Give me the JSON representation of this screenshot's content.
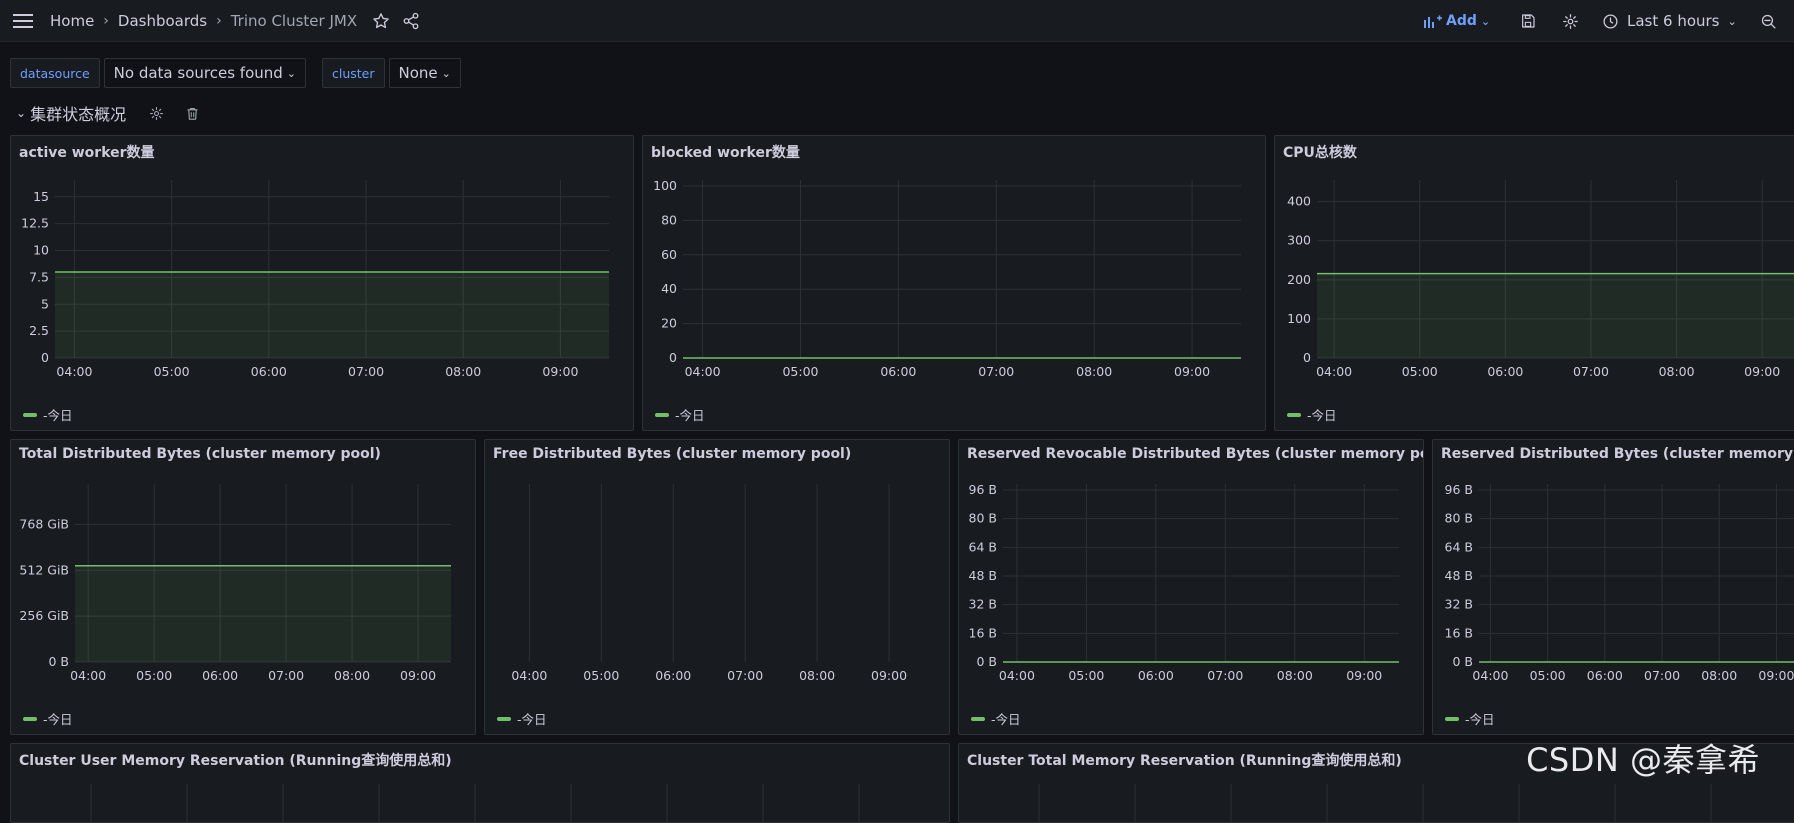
{
  "topbar": {
    "breadcrumbs": [
      "Home",
      "Dashboards",
      "Trino Cluster JMX"
    ],
    "add_label": "Add",
    "time_range": "Last 6 hours"
  },
  "variables": [
    {
      "label": "datasource",
      "value": "No data sources found"
    },
    {
      "label": "cluster",
      "value": "None"
    }
  ],
  "row": {
    "title": "集群状态概况"
  },
  "watermark": "CSDN @秦拿希",
  "colors": {
    "series": "#73bf69",
    "accent": "#6e9fff",
    "panel_bg": "#181b1f",
    "page_bg": "#111217"
  },
  "panels": [
    {
      "title": "active worker数量",
      "legend": "-今日",
      "chart_data": {
        "type": "area",
        "series_name": "-今日",
        "x": [
          "04:00",
          "05:00",
          "06:00",
          "07:00",
          "08:00",
          "09:00"
        ],
        "value": 8,
        "ylim": [
          0,
          16
        ],
        "yticks": [
          0,
          2.5,
          5,
          7.5,
          10,
          12.5,
          15
        ],
        "ytick_labels": [
          "0",
          "2.5",
          "5",
          "7.5",
          "10",
          "12.5",
          "15"
        ]
      }
    },
    {
      "title": "blocked worker数量",
      "legend": "-今日",
      "chart_data": {
        "type": "line",
        "series_name": "-今日",
        "x": [
          "04:00",
          "05:00",
          "06:00",
          "07:00",
          "08:00",
          "09:00"
        ],
        "value": 0,
        "ylim": [
          0,
          100
        ],
        "yticks": [
          0,
          20,
          40,
          60,
          80,
          100
        ],
        "ytick_labels": [
          "0",
          "20",
          "40",
          "60",
          "80",
          "100"
        ]
      }
    },
    {
      "title": "CPU总核数",
      "legend": "-今日",
      "chart_data": {
        "type": "area",
        "series_name": "-今日",
        "x": [
          "04:00",
          "05:00",
          "06:00",
          "07:00",
          "08:00",
          "09:00"
        ],
        "value": 216,
        "ylim": [
          0,
          440
        ],
        "yticks": [
          0,
          100,
          200,
          300,
          400
        ],
        "ytick_labels": [
          "0",
          "100",
          "200",
          "300",
          "400"
        ]
      }
    },
    {
      "title": "Total Distributed Bytes (cluster memory pool)",
      "legend": "-今日",
      "chart_data": {
        "type": "area",
        "series_name": "-今日",
        "x": [
          "04:00",
          "05:00",
          "06:00",
          "07:00",
          "08:00",
          "09:00"
        ],
        "value": 537,
        "ylim": [
          0,
          960
        ],
        "yticks": [
          0,
          256,
          512,
          768
        ],
        "ytick_labels": [
          "0 B",
          "256 GiB",
          "512 GiB",
          "768 GiB"
        ]
      }
    },
    {
      "title": "Free Distributed Bytes (cluster memory pool)",
      "legend": "-今日",
      "chart_data": {
        "type": "line",
        "series_name": "-今日",
        "x": [
          "04:00",
          "05:00",
          "06:00",
          "07:00",
          "08:00",
          "09:00"
        ],
        "value": null,
        "ylim": [
          0,
          1
        ],
        "yticks": [],
        "ytick_labels": []
      }
    },
    {
      "title": "Reserved Revocable Distributed Bytes (cluster memory pool)",
      "legend": "-今日",
      "chart_data": {
        "type": "line",
        "series_name": "-今日",
        "x": [
          "04:00",
          "05:00",
          "06:00",
          "07:00",
          "08:00",
          "09:00"
        ],
        "value": 0,
        "ylim": [
          0,
          96
        ],
        "yticks": [
          0,
          16,
          32,
          48,
          64,
          80,
          96
        ],
        "ytick_labels": [
          "0 B",
          "16 B",
          "32 B",
          "48 B",
          "64 B",
          "80 B",
          "96 B"
        ]
      }
    },
    {
      "title": "Reserved Distributed Bytes (cluster memory pool)",
      "legend": "-今日",
      "chart_data": {
        "type": "line",
        "series_name": "-今日",
        "x": [
          "04:00",
          "05:00",
          "06:00",
          "07:00",
          "08:00",
          "09:00"
        ],
        "value": 0,
        "ylim": [
          0,
          96
        ],
        "yticks": [
          0,
          16,
          32,
          48,
          64,
          80,
          96
        ],
        "ytick_labels": [
          "0 B",
          "16 B",
          "32 B",
          "48 B",
          "64 B",
          "80 B",
          "96 B"
        ]
      }
    },
    {
      "title": "Cluster User Memory Reservation (Running查询使用总和)",
      "legend": "",
      "chart_data": {
        "type": "line",
        "x": [],
        "value": null,
        "ylim": [
          0,
          1
        ],
        "yticks": [],
        "ytick_labels": []
      }
    },
    {
      "title": "Cluster Total Memory Reservation (Running查询使用总和)",
      "legend": "",
      "chart_data": {
        "type": "line",
        "x": [],
        "value": null,
        "ylim": [
          0,
          1
        ],
        "yticks": [],
        "ytick_labels": []
      }
    }
  ]
}
